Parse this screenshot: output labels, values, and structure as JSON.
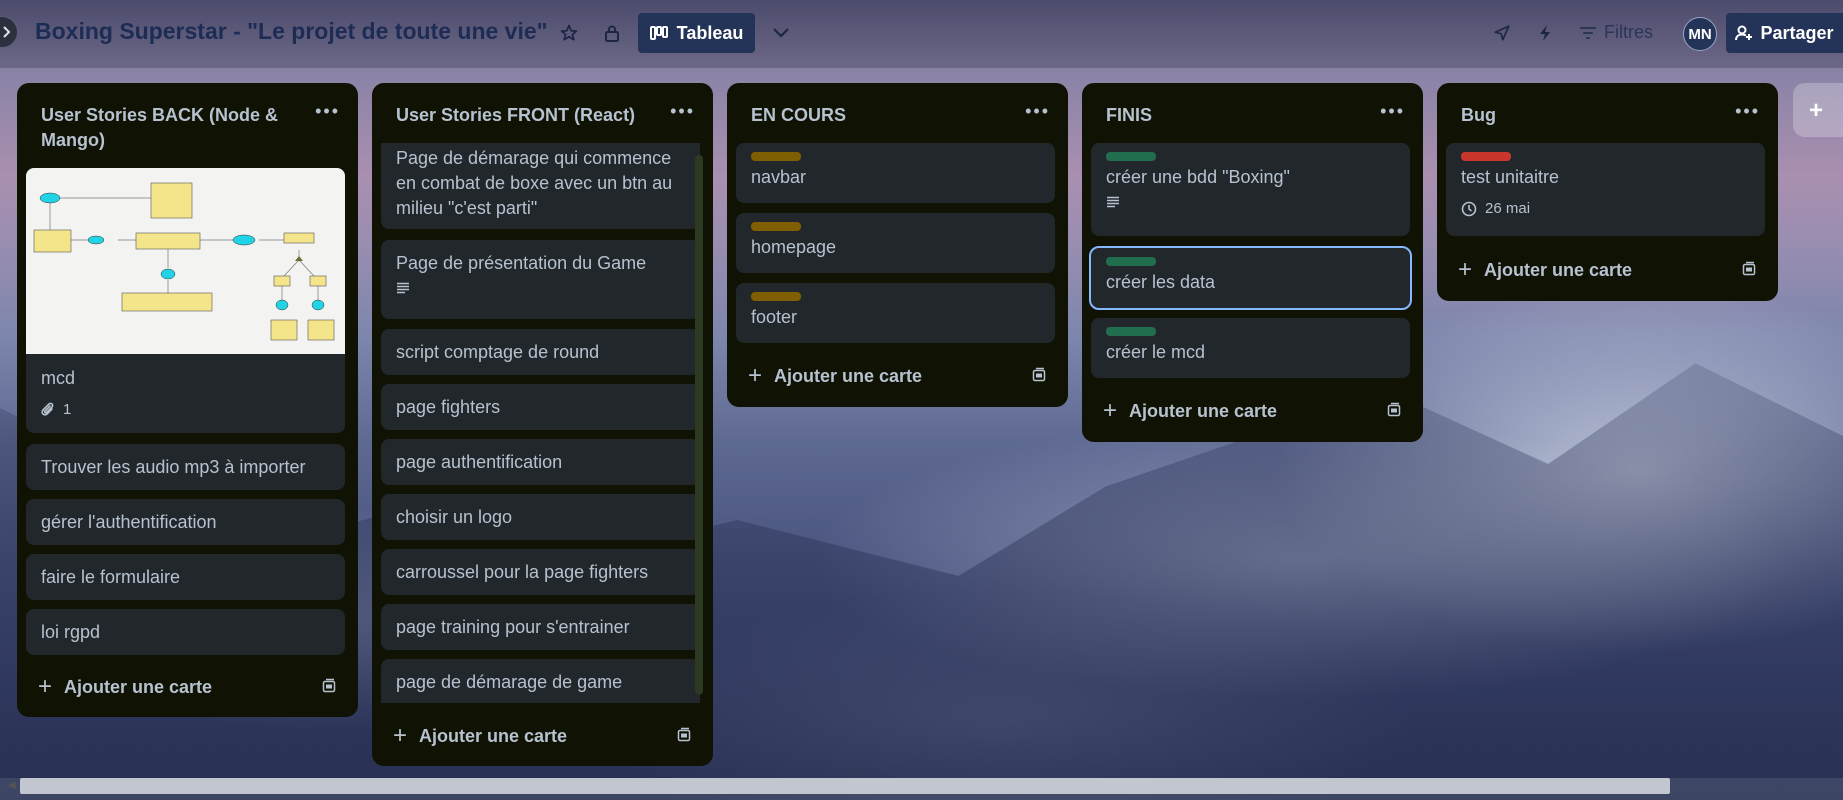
{
  "board": {
    "title": "Boxing Superstar - \"Le projet de toute une vie\"",
    "view_label": "Tableau",
    "filters_label": "Filtres",
    "avatar_initials": "MN",
    "share_label": "Partager",
    "add_list_label": "+"
  },
  "labels": {
    "yellow": "#7f5f01",
    "green": "#216e4e",
    "red": "#c9372c"
  },
  "columns": [
    {
      "title": "User Stories BACK (Node & Mango)",
      "add_label": "Ajouter une carte",
      "cards": [
        {
          "text": "mcd",
          "attachments": "1"
        },
        {
          "text": "Trouver les audio mp3 à importer"
        },
        {
          "text": "gérer l'authentification"
        },
        {
          "text": "faire le formulaire"
        },
        {
          "text": "loi rgpd"
        }
      ]
    },
    {
      "title": "User Stories FRONT (React)",
      "add_label": "Ajouter une carte",
      "cards": [
        {
          "text": "Page de démarage qui commence en combat de boxe avec un btn au milieu \"c'est parti\""
        },
        {
          "text": "Page de présentation du Game"
        },
        {
          "text": "script comptage de round"
        },
        {
          "text": "page fighters"
        },
        {
          "text": "page authentification"
        },
        {
          "text": "choisir un logo"
        },
        {
          "text": "carroussel pour la page fighters"
        },
        {
          "text": "page training pour s'entrainer"
        },
        {
          "text": "page de démarage de game"
        }
      ]
    },
    {
      "title": "EN COURS",
      "add_label": "Ajouter une carte",
      "cards": [
        {
          "text": "navbar"
        },
        {
          "text": "homepage"
        },
        {
          "text": "footer"
        }
      ]
    },
    {
      "title": "FINIS",
      "add_label": "Ajouter une carte",
      "cards": [
        {
          "text": "créer une bdd \"Boxing\""
        },
        {
          "text": "créer les data"
        },
        {
          "text": "créer le mcd"
        }
      ]
    },
    {
      "title": "Bug",
      "add_label": "Ajouter une carte",
      "cards": [
        {
          "text": "test unitaitre",
          "due": "26 mai"
        }
      ]
    }
  ]
}
